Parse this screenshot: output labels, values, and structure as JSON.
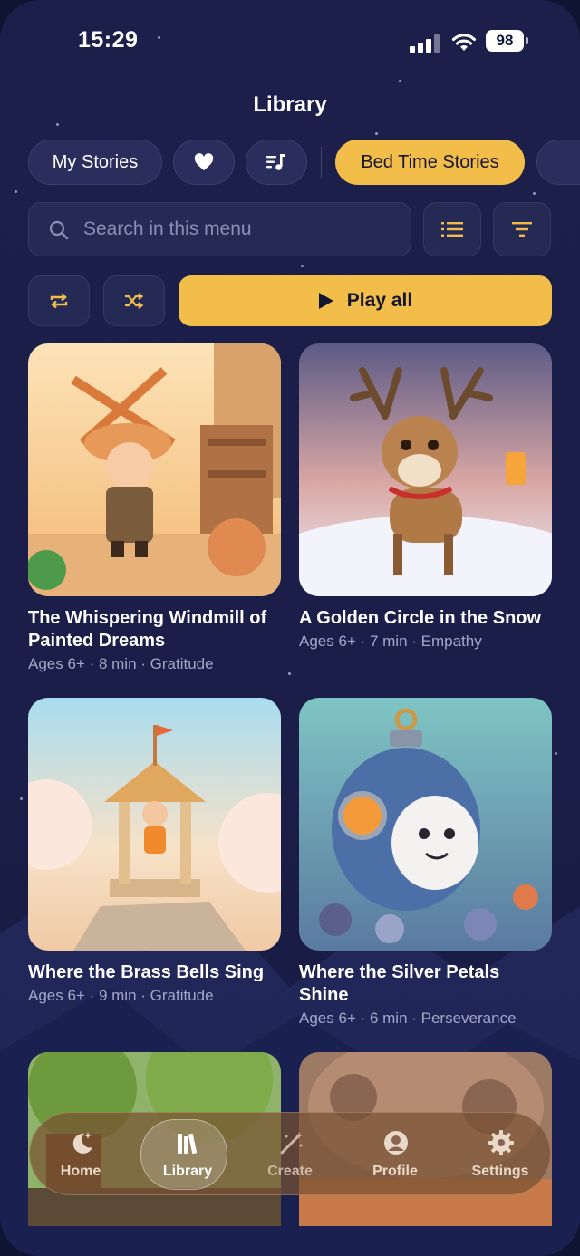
{
  "status_bar": {
    "time": "15:29",
    "battery": "98"
  },
  "header": {
    "title": "Library"
  },
  "filters": {
    "my_stories": "My Stories",
    "favorites_icon": "heart-icon",
    "music_icon": "music-list-icon",
    "active_category": "Bed Time Stories"
  },
  "search": {
    "placeholder": "Search in this menu"
  },
  "controls": {
    "list_view_icon": "list-icon",
    "filter_icon": "filter-icon",
    "repeat_icon": "repeat-icon",
    "shuffle_icon": "shuffle-icon",
    "play_all_label": "Play all"
  },
  "stories": [
    {
      "title": "The Whispering Windmill of Painted Dreams",
      "meta": "Ages 6+ · 8 min · Gratitude"
    },
    {
      "title": "A Golden Circle in the Snow",
      "meta": "Ages 6+ · 7 min · Empathy"
    },
    {
      "title": "Where the Brass Bells Sing",
      "meta": "Ages 6+ · 9 min · Gratitude"
    },
    {
      "title": "Where the Silver Petals Shine",
      "meta": "Ages 6+ · 6 min · Perseverance"
    }
  ],
  "nav": {
    "items": [
      {
        "label": "Home",
        "icon": "moon-stars-icon"
      },
      {
        "label": "Library",
        "icon": "books-icon",
        "active": true
      },
      {
        "label": "Create",
        "icon": "magic-wand-icon"
      },
      {
        "label": "Profile",
        "icon": "user-icon"
      },
      {
        "label": "Settings",
        "icon": "gear-icon"
      }
    ]
  },
  "colors": {
    "accent": "#f2bd48",
    "background": "#1b1f4a"
  }
}
